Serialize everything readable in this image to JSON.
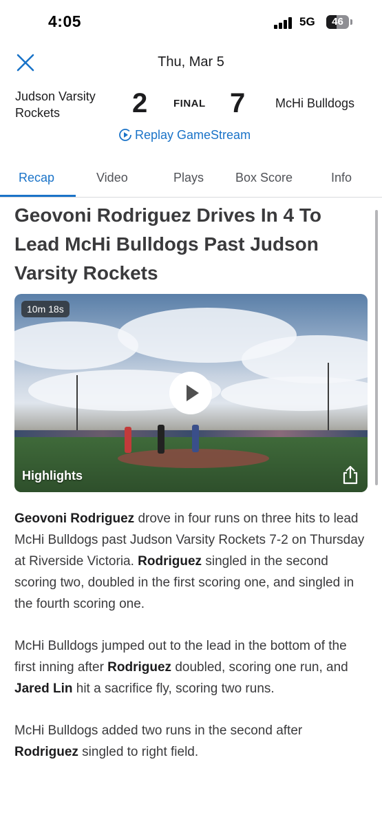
{
  "status_bar": {
    "time": "4:05",
    "network": "5G",
    "battery": "46"
  },
  "header": {
    "date": "Thu, Mar 5",
    "close_icon": "close-icon"
  },
  "game": {
    "home_team": "Judson Varsity Rockets",
    "home_score": "2",
    "status": "FINAL",
    "away_score": "7",
    "away_team": "McHi Bulldogs",
    "replay_label": "Replay GameStream"
  },
  "tabs": [
    {
      "label": "Recap",
      "active": true
    },
    {
      "label": "Video",
      "active": false
    },
    {
      "label": "Plays",
      "active": false
    },
    {
      "label": "Box Score",
      "active": false
    },
    {
      "label": "Info",
      "active": false
    }
  ],
  "article": {
    "headline": "Geovoni Rodriguez Drives In 4 To Lead McHi Bulldogs Past Judson Varsity Rockets",
    "video": {
      "duration": "10m 18s",
      "label": "Highlights"
    },
    "paragraphs": [
      [
        {
          "text": "Geovoni Rodriguez",
          "bold": true
        },
        {
          "text": " drove in four runs on three hits to lead McHi Bulldogs past Judson Varsity Rockets 7-2 on Thursday at Riverside Victoria. ",
          "bold": false
        },
        {
          "text": "Rodriguez",
          "bold": true
        },
        {
          "text": " singled in the second scoring two, doubled in the first scoring one, and singled in the fourth scoring one.",
          "bold": false
        }
      ],
      [
        {
          "text": "McHi Bulldogs jumped out to the lead in the bottom of the first inning after ",
          "bold": false
        },
        {
          "text": "Rodriguez",
          "bold": true
        },
        {
          "text": " doubled, scoring one run, and ",
          "bold": false
        },
        {
          "text": "Jared Lin",
          "bold": true
        },
        {
          "text": " hit a sacrifice fly, scoring two runs.",
          "bold": false
        }
      ],
      [
        {
          "text": "McHi Bulldogs added two runs in the second after ",
          "bold": false
        },
        {
          "text": "Rodriguez",
          "bold": true
        },
        {
          "text": " singled to right field.",
          "bold": false
        }
      ]
    ]
  },
  "colors": {
    "accent": "#1a73c8",
    "text": "#1c1c1e",
    "body_text": "#3a3a3c"
  }
}
